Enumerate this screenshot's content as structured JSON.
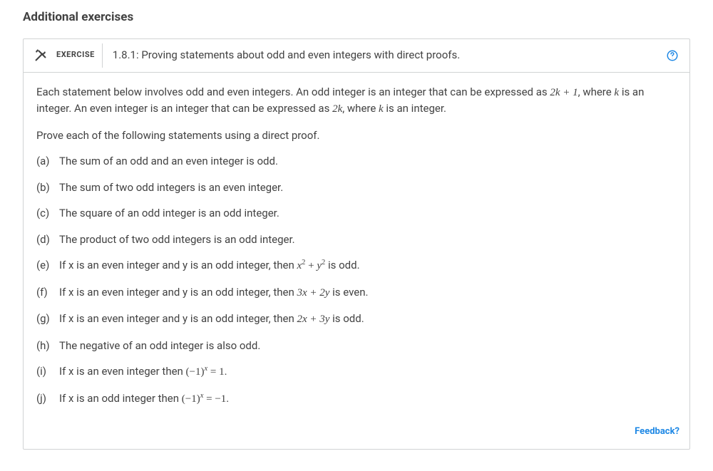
{
  "section_title": "Additional exercises",
  "exercise": {
    "label": "EXERCISE",
    "number_title": "1.8.1: Proving statements about odd and even integers with direct proofs.",
    "intro_pre": "Each statement below involves odd and even integers. An odd integer is an integer that can be expressed as ",
    "intro_mid1": ", where ",
    "intro_mid2": " is an integer. An even integer is an integer that can be expressed as ",
    "intro_mid3": ", where ",
    "intro_end": " is an integer.",
    "prove_line": "Prove each of the following statements using a direct proof.",
    "items": {
      "a": {
        "marker": "(a)",
        "text": "The sum of an odd and an even integer is odd."
      },
      "b": {
        "marker": "(b)",
        "text": "The sum of two odd integers is an even integer."
      },
      "c": {
        "marker": "(c)",
        "text": "The square of an odd integer is an odd integer."
      },
      "d": {
        "marker": "(d)",
        "text": "The product of two odd integers is an odd integer."
      },
      "e": {
        "marker": "(e)",
        "pre": "If x is an even integer and y is an odd integer, then ",
        "post": " is odd."
      },
      "f": {
        "marker": "(f)",
        "pre": "If x is an even integer and y is an odd integer, then ",
        "post": " is even."
      },
      "g": {
        "marker": "(g)",
        "pre": "If x is an even integer and y is an odd integer, then ",
        "post": " is odd."
      },
      "h": {
        "marker": "(h)",
        "text": "The negative of an odd integer is also odd."
      },
      "i": {
        "marker": "(i)",
        "pre": "If x is an even integer then ",
        "post": "."
      },
      "j": {
        "marker": "(j)",
        "pre": "If x is an odd integer then ",
        "post": "."
      }
    },
    "math": {
      "two_k_plus_1": "2k + 1",
      "k": "k",
      "two_k": "2k",
      "x2_plus_y2_x": "x",
      "x2_plus_y2_plus": " + ",
      "x2_plus_y2_y": "y",
      "sq": "2",
      "three_x_plus_two_y": "3x + 2y",
      "two_x_plus_three_y": "2x + 3y",
      "neg1": "(−1)",
      "eq_one": " = 1",
      "eq_neg_one": " = −1",
      "sup_x": "x"
    }
  },
  "feedback": "Feedback?"
}
